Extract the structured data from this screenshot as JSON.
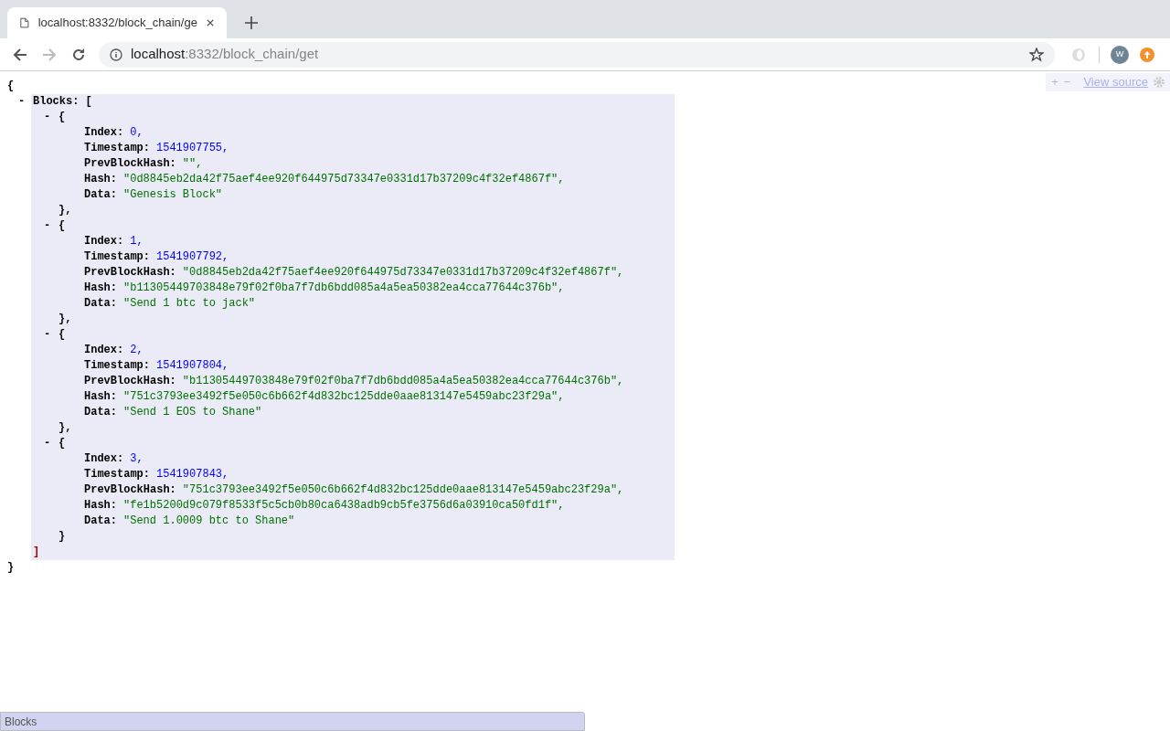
{
  "browser": {
    "tab_title": "localhost:8332/block_chain/ge",
    "address_host": "localhost",
    "address_rest": ":8332/block_chain/get",
    "avatar": "W"
  },
  "viewer_toolbar": {
    "expand": "+",
    "collapse": "−",
    "view_source": "View source"
  },
  "document": {
    "open": "{",
    "close": "}",
    "toggle": "-",
    "key": "Blocks:",
    "array_open": "[",
    "array_close": "]",
    "blocks": [
      {
        "toggle": "-",
        "open": "{",
        "close": "},",
        "fields": [
          {
            "key": "Index:",
            "value": "0",
            "kind": "number",
            "sep": ","
          },
          {
            "key": "Timestamp:",
            "value": "1541907755",
            "kind": "number",
            "sep": ","
          },
          {
            "key": "PrevBlockHash:",
            "value": "\"\"",
            "kind": "string",
            "sep": ","
          },
          {
            "key": "Hash:",
            "value": "\"0d8845eb2da42f75aef4ee920f644975d73347e0331d17b37209c4f32ef4867f\"",
            "kind": "string",
            "sep": ","
          },
          {
            "key": "Data:",
            "value": "\"Genesis Block\"",
            "kind": "string"
          }
        ]
      },
      {
        "toggle": "-",
        "open": "{",
        "close": "},",
        "fields": [
          {
            "key": "Index:",
            "value": "1",
            "kind": "number",
            "sep": ","
          },
          {
            "key": "Timestamp:",
            "value": "1541907792",
            "kind": "number",
            "sep": ","
          },
          {
            "key": "PrevBlockHash:",
            "value": "\"0d8845eb2da42f75aef4ee920f644975d73347e0331d17b37209c4f32ef4867f\"",
            "kind": "string",
            "sep": ","
          },
          {
            "key": "Hash:",
            "value": "\"b11305449703848e79f02f0ba7f7db6bdd085a4a5ea50382ea4cca77644c376b\"",
            "kind": "string",
            "sep": ","
          },
          {
            "key": "Data:",
            "value": "\"Send 1 btc to jack\"",
            "kind": "string"
          }
        ]
      },
      {
        "toggle": "-",
        "open": "{",
        "close": "},",
        "fields": [
          {
            "key": "Index:",
            "value": "2",
            "kind": "number",
            "sep": ","
          },
          {
            "key": "Timestamp:",
            "value": "1541907804",
            "kind": "number",
            "sep": ","
          },
          {
            "key": "PrevBlockHash:",
            "value": "\"b11305449703848e79f02f0ba7f7db6bdd085a4a5ea50382ea4cca77644c376b\"",
            "kind": "string",
            "sep": ","
          },
          {
            "key": "Hash:",
            "value": "\"751c3793ee3492f5e050c6b662f4d832bc125dde0aae813147e5459abc23f29a\"",
            "kind": "string",
            "sep": ","
          },
          {
            "key": "Data:",
            "value": "\"Send 1 EOS to Shane\"",
            "kind": "string"
          }
        ]
      },
      {
        "toggle": "-",
        "open": "{",
        "close": "}",
        "fields": [
          {
            "key": "Index:",
            "value": "3",
            "kind": "number",
            "sep": ","
          },
          {
            "key": "Timestamp:",
            "value": "1541907843",
            "kind": "number",
            "sep": ","
          },
          {
            "key": "PrevBlockHash:",
            "value": "\"751c3793ee3492f5e050c6b662f4d832bc125dde0aae813147e5459abc23f29a\"",
            "kind": "string",
            "sep": ","
          },
          {
            "key": "Hash:",
            "value": "\"fe1b5200d9c079f8533f5c5cb0b80ca6438adb9cb5fe3756d6a03910ca50fd1f\"",
            "kind": "string",
            "sep": ","
          },
          {
            "key": "Data:",
            "value": "\"Send 1.0009 btc to Shane\"",
            "kind": "string"
          }
        ]
      }
    ]
  },
  "status_bar": {
    "path": "Blocks"
  }
}
